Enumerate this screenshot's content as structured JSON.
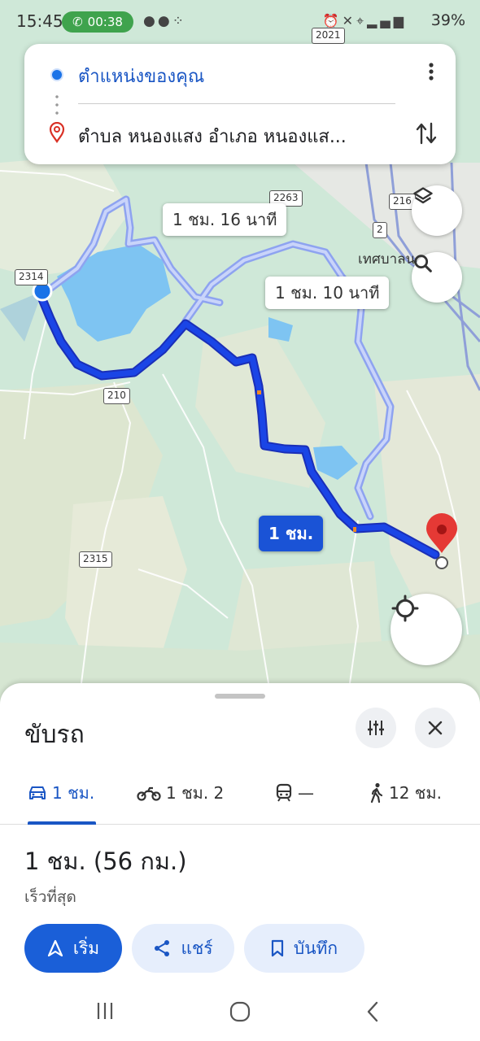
{
  "status_bar": {
    "time": "15:45",
    "call_timer": "00:38",
    "battery": "39%",
    "icons": [
      "chat-icon",
      "line-icon",
      "dots-icon",
      "alarm-icon",
      "mute-icon",
      "location-icon",
      "volte-icon",
      "4g-icon",
      "signal-icon",
      "battery-icon"
    ]
  },
  "route_search": {
    "origin": "ตำแหน่งของคุณ",
    "destination": "ตำบล หนองแสง อำเภอ หนองแส..."
  },
  "map": {
    "route_labels": {
      "alt1": "1 ชม. 16 นาที",
      "alt2": "1 ชม. 10 นาที",
      "primary": "1 ชม."
    },
    "road_numbers": [
      "2021",
      "2263",
      "216",
      "2",
      "2314",
      "210",
      "2315"
    ],
    "place_label": "เทศบาลน",
    "colors": {
      "primary_route": "#1a45e6",
      "alt_route": "#a9b8f5",
      "water": "#7ec4f2",
      "land": "#cfe8d8"
    }
  },
  "sheet": {
    "title": "ขับรถ",
    "tabs": [
      {
        "icon": "car-icon",
        "label": "1 ชม."
      },
      {
        "icon": "motorbike-icon",
        "label": "1 ชม. 2"
      },
      {
        "icon": "transit-icon",
        "label": "—"
      },
      {
        "icon": "walk-icon",
        "label": "12 ชม."
      }
    ],
    "summary": "1 ชม. (56 กม.)",
    "subtitle": "เร็วที่สุด",
    "buttons": {
      "start": "เริ่ม",
      "share": "แชร์",
      "save": "บันทึก"
    }
  },
  "navbar": {
    "icons": [
      "recent-apps-icon",
      "home-icon",
      "back-icon"
    ]
  }
}
